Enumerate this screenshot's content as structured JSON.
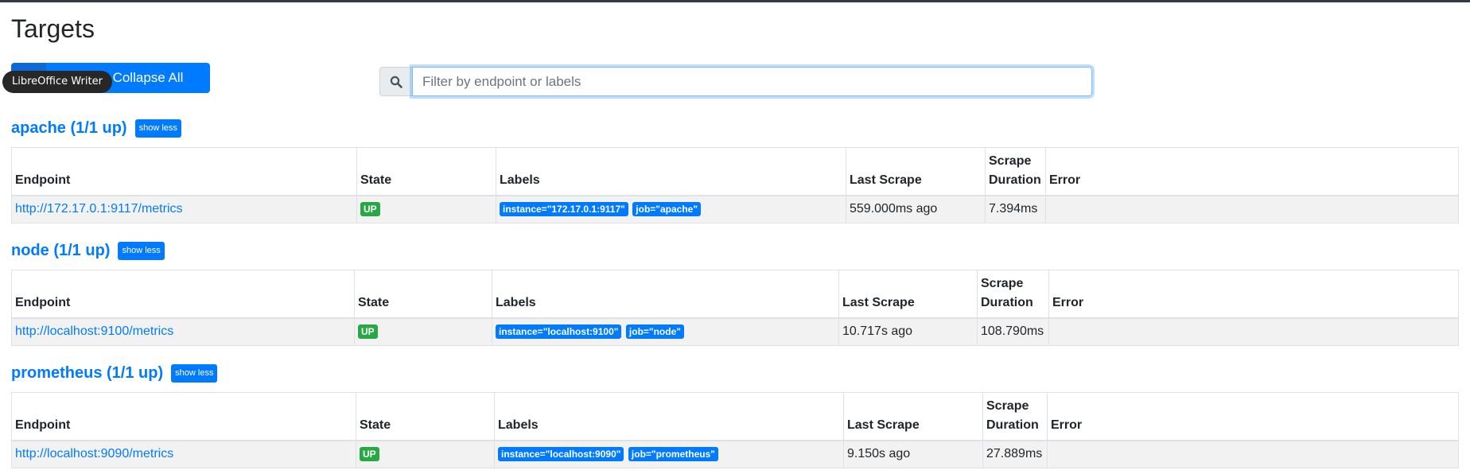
{
  "page": {
    "title": "Targets"
  },
  "toolbar": {
    "collapse_label": "Collapse All",
    "tooltip": "LibreOffice Writer"
  },
  "search": {
    "placeholder": "Filter by endpoint or labels"
  },
  "table_headers": {
    "endpoint": "Endpoint",
    "state": "State",
    "labels": "Labels",
    "last_scrape": "Last Scrape",
    "scrape_duration_1": "Scrape",
    "scrape_duration_2": "Duration",
    "error": "Error"
  },
  "pools": [
    {
      "title": "apache (1/1 up)",
      "toggle_label": "show less",
      "target": {
        "endpoint": "http://172.17.0.1:9117/metrics",
        "state": "UP",
        "labels": [
          "instance=\"172.17.0.1:9117\"",
          "job=\"apache\""
        ],
        "last_scrape": "559.000ms ago",
        "scrape_duration": "7.394ms",
        "error": ""
      }
    },
    {
      "title": "node (1/1 up)",
      "toggle_label": "show less",
      "target": {
        "endpoint": "http://localhost:9100/metrics",
        "state": "UP",
        "labels": [
          "instance=\"localhost:9100\"",
          "job=\"node\""
        ],
        "last_scrape": "10.717s ago",
        "scrape_duration": "108.790ms",
        "error": ""
      }
    },
    {
      "title": "prometheus (1/1 up)",
      "toggle_label": "show less",
      "target": {
        "endpoint": "http://localhost:9090/metrics",
        "state": "UP",
        "labels": [
          "instance=\"localhost:9090\"",
          "job=\"prometheus\""
        ],
        "last_scrape": "9.150s ago",
        "scrape_duration": "27.889ms",
        "error": ""
      }
    }
  ],
  "colors": {
    "primary": "#007bff",
    "success": "#28a745",
    "topbar": "#343a40"
  },
  "icons": {
    "search": "search-icon"
  }
}
